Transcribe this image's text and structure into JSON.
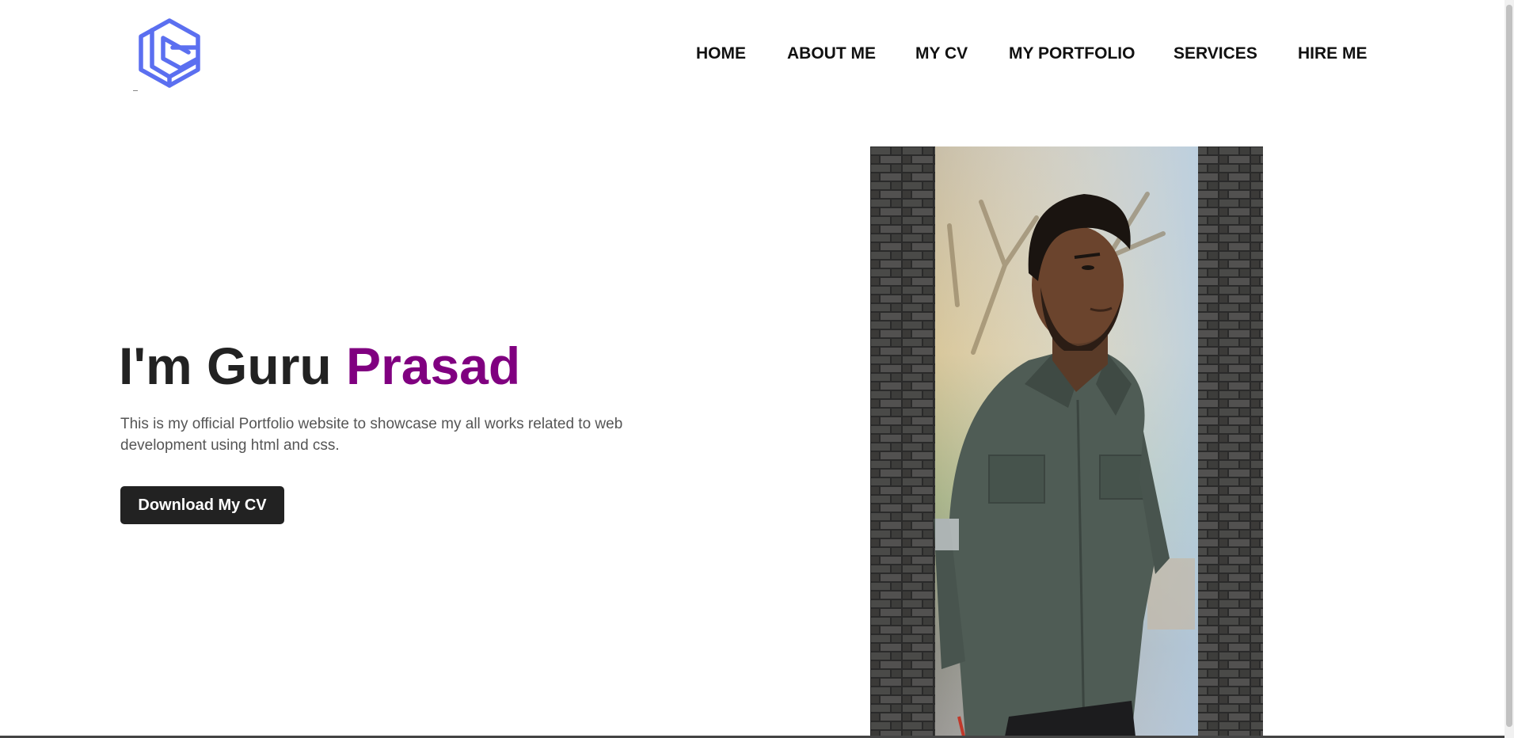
{
  "header": {
    "logo_icon": "layered-hexagon-logo-icon",
    "logo_color": "#5b6ff0",
    "nav": [
      {
        "label": "HOME"
      },
      {
        "label": "ABOUT ME"
      },
      {
        "label": "MY CV"
      },
      {
        "label": "MY PORTFOLIO"
      },
      {
        "label": "SERVICES"
      },
      {
        "label": "HIRE ME"
      }
    ]
  },
  "hero": {
    "title_prefix": "I'm Guru ",
    "title_accent": "Prasad",
    "accent_color": "#800080",
    "description": "This is my official Portfolio website to showcase my all works related to web development using html and css.",
    "cta_label": "Download My CV"
  }
}
